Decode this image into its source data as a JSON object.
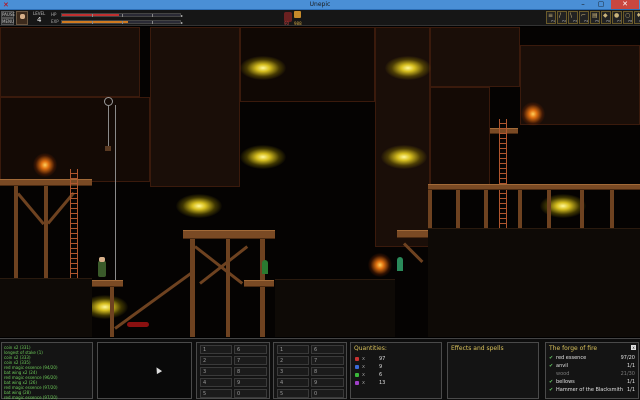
{
  "window": {
    "title": "Unepic",
    "app_icon": "unepic-app-icon"
  },
  "hud": {
    "pause_btn": "PAUSE",
    "menu_btn": "MENU",
    "level_label": "LEVEL",
    "level_value": "4",
    "hp_label": "HP",
    "exp_label": "EXP",
    "hp_fraction": 0.48,
    "exp_fraction": 0.56,
    "companion_count": "90",
    "gold": "988",
    "fkeys": [
      {
        "label": "F1",
        "icon": "scroll-icon"
      },
      {
        "label": "F2",
        "icon": "sword-icon"
      },
      {
        "label": "F3",
        "icon": "wand-icon"
      },
      {
        "label": "F4",
        "icon": "pickaxe-icon"
      },
      {
        "label": "F5",
        "icon": "book-icon"
      },
      {
        "label": "F6",
        "icon": "shield-icon"
      },
      {
        "label": "F7",
        "icon": "potion-icon"
      },
      {
        "label": "F8",
        "icon": "ring-icon"
      },
      {
        "label": "F9",
        "icon": "gem-icon"
      }
    ]
  },
  "log": {
    "lines": [
      "coin x2 (331)",
      "longest of stake (1)",
      "coin x2 (333)",
      "coin x2 (335)",
      "red magic essence (94/20)",
      "bat wing x2 (24)",
      "red magic essence (96/20)",
      "bat wing x2 (26)",
      "red magic essence (97/20)",
      "bat wing (28)",
      "red magic essence (97/20)"
    ]
  },
  "slots": {
    "left": [
      "1",
      "2",
      "3",
      "4",
      "5"
    ],
    "right": [
      "6",
      "7",
      "8",
      "9",
      "0"
    ]
  },
  "slots2": {
    "left": [
      "1",
      "2",
      "3",
      "4",
      "5"
    ],
    "right": [
      "6",
      "7",
      "8",
      "9",
      "0"
    ]
  },
  "quantities": {
    "title": "Quantities:",
    "rows": [
      {
        "color": "#c83232",
        "x": "x",
        "value": "97"
      },
      {
        "color": "#3a6ad8",
        "x": "x",
        "value": "9"
      },
      {
        "color": "#3ab83a",
        "x": "x",
        "value": "6"
      },
      {
        "color": "#a040c8",
        "x": "x",
        "value": "13"
      }
    ]
  },
  "effects": {
    "title": "Effects and spells"
  },
  "forge": {
    "title": "The forge of fire",
    "items": [
      {
        "check": "✔",
        "name": "red essence",
        "count": "97/20",
        "dim": false
      },
      {
        "check": "✔",
        "name": "anvil",
        "count": "1/1",
        "dim": false
      },
      {
        "check": "",
        "name": "wood",
        "count": "21/30",
        "dim": true
      },
      {
        "check": "✔",
        "name": "bellows",
        "count": "1/1",
        "dim": false
      },
      {
        "check": "✔",
        "name": "Hammer of the Blacksmith",
        "count": "1/1",
        "dim": false
      }
    ]
  }
}
